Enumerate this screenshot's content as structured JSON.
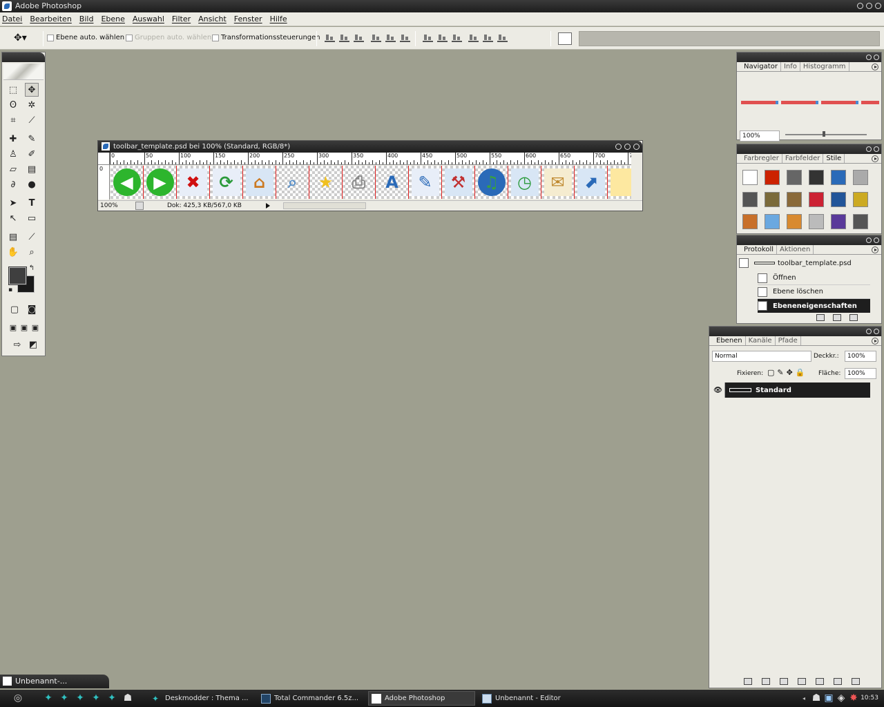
{
  "app": {
    "title": "Adobe Photoshop"
  },
  "menu": [
    "Datei",
    "Bearbeiten",
    "Bild",
    "Ebene",
    "Auswahl",
    "Filter",
    "Ansicht",
    "Fenster",
    "Hilfe"
  ],
  "options": {
    "auto_select_layer": "Ebene auto. wählen",
    "auto_select_groups": "Gruppen auto. wählen",
    "transform_controls": "Transformationssteuerungen"
  },
  "document": {
    "title": "toolbar_template.psd bei 100% (Standard, RGB/8*)",
    "zoom": "100%",
    "doc_size": "Dok: 425,3 KB/567,0 KB",
    "ruler_labels": [
      "0",
      "50",
      "100",
      "150",
      "200",
      "250",
      "300",
      "350",
      "400",
      "450",
      "500",
      "550",
      "600",
      "650",
      "700",
      "7"
    ],
    "icons": [
      "back-arrow",
      "forward-arrow",
      "stop-page",
      "refresh",
      "home",
      "search",
      "favorites-star",
      "print",
      "font",
      "edit",
      "tools",
      "web-music",
      "history-clock",
      "mail",
      "open-window",
      "note"
    ]
  },
  "navigator": {
    "tabs": [
      "Navigator",
      "Info",
      "Histogramm"
    ],
    "zoom": "100%"
  },
  "swatches": {
    "tabs": [
      "Farbregler",
      "Farbfelder",
      "Stile"
    ],
    "styles": [
      "#ffffff",
      "#cc2200",
      "#666666",
      "#333333",
      "#2a6ab8",
      "#aaaaaa",
      "#555555",
      "#7a6a3a",
      "#8a6a3a",
      "#cc2233",
      "#225599",
      "#ccaa22",
      "#c8702a",
      "#6aa8e0",
      "#d88a30",
      "#bbbbbb",
      "#5a3a9a",
      "#555555"
    ]
  },
  "history": {
    "tabs": [
      "Protokoll",
      "Aktionen"
    ],
    "snapshot": "toolbar_template.psd",
    "items": [
      "Öffnen",
      "Ebene löschen",
      "Ebeneneigenschaften"
    ]
  },
  "layers": {
    "tabs": [
      "Ebenen",
      "Kanäle",
      "Pfade"
    ],
    "blend_mode": "Normal",
    "opacity_label": "Deckkr.:",
    "opacity": "100%",
    "lock_label": "Fixieren:",
    "fill_label": "Fläche:",
    "fill": "100%",
    "layer_name": "Standard"
  },
  "minimized": "Unbenannt-...",
  "taskbar": {
    "tasks": [
      "Deskmodder : Thema ...",
      "Total Commander 6.5z...",
      "Adobe Photoshop",
      "Unbenannt - Editor"
    ],
    "clock": "10:53"
  }
}
